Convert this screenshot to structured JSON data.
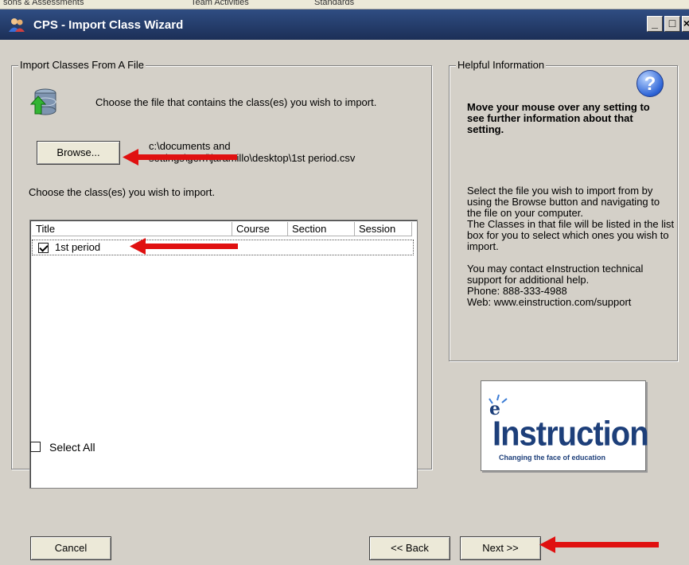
{
  "background_windows": {
    "items": [
      "sons & Assessments",
      "Team Activities",
      "Standards"
    ]
  },
  "window": {
    "title": "CPS - Import Class Wizard",
    "controls": {
      "minimize": "_",
      "maximize": "□",
      "close": "×"
    }
  },
  "import_group": {
    "legend": "Import Classes From A File",
    "instruction": "Choose the file that contains the class(es) you wish to import.",
    "browse_label": "Browse...",
    "file_path_line1": "c:\\documents and",
    "file_path_line2": "settings\\gerri\\jaramillo\\desktop\\1st period.csv",
    "choose_classes_label": "Choose the class(es) you wish to import.",
    "columns": [
      "Title",
      "Course",
      "Section",
      "Session"
    ],
    "rows": [
      {
        "title": "1st period",
        "course": "",
        "section": "",
        "session": "",
        "checked": true
      }
    ],
    "select_all_label": "Select All",
    "select_all_checked": false
  },
  "help_group": {
    "legend": "Helpful Information",
    "icon": "help-question-icon",
    "bold_text": "Move your mouse over any setting to see further information about that setting.",
    "body_text_1": "Select the file you wish to import from by using the Browse button and navigating to the file on your computer.",
    "body_text_2": "The Classes in that file will be listed in the list box for you to select which ones you wish to import.",
    "body_text_3": "You may contact eInstruction technical support for additional help.",
    "phone": "Phone: 888-333-4988",
    "web": "Web: www.einstruction.com/support"
  },
  "logo": {
    "brand": "Instruction",
    "prefix": "e",
    "tagline": "Changing the face of education"
  },
  "footer": {
    "cancel_label": "Cancel",
    "back_label": "<< Back",
    "next_label": "Next >>"
  },
  "colors": {
    "title_bar": "#1c2f57",
    "dialog_bg": "#d4d0c8",
    "arrow_red": "#e01010",
    "logo_blue": "#1d3f7a"
  }
}
